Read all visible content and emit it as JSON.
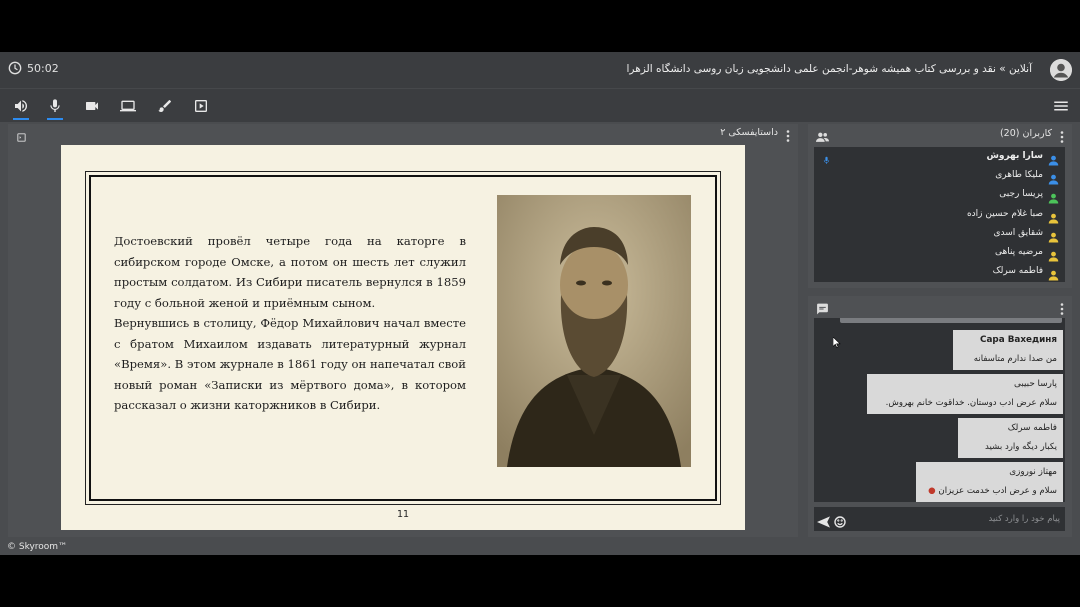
{
  "header": {
    "timer": "50:02",
    "room_title": "آنلاین » نقد و بررسی کتاب همیشه شوهر-انجمن علمی دانشجویی زبان روسی دانشگاه الزهرا"
  },
  "toolbar": {
    "tools": [
      "speaker-icon",
      "microphone-icon",
      "camera-icon",
      "screen-share-icon",
      "brush-icon",
      "play-media-icon"
    ],
    "menu": "hamburger-menu-icon",
    "accent": "#2d8cf0"
  },
  "presentation": {
    "name": "داستایفسکی ۲",
    "page_number": "11",
    "paragraphs": [
      "Достоевский провёл четыре года на каторге в сибирском городе Омске, а потом он шесть лет служил простым солдатом. Из Сибири писатель вернулся в 1859 году с больной женой и приёмным сыном.",
      "Вернувшись в столицу, Фёдор Михайлович начал вместе с братом Михаилом издавать литературный журнал «Время». В этом журнале в 1861 году он напечатал свой новый роман «Записки из мёртвого дома», в котором рассказал о жизни каторжников в Сибири."
    ]
  },
  "users": {
    "title": "کاربران (20)",
    "list": [
      {
        "name": "سارا بهروش",
        "role_color": "#3b8fe8",
        "bold": true,
        "mic": true
      },
      {
        "name": "ملیکا طاهری",
        "role_color": "#3b8fe8",
        "bold": false,
        "mic": false
      },
      {
        "name": "پریسا رجبی",
        "role_color": "#4cc35a",
        "bold": false,
        "mic": false
      },
      {
        "name": "صبا غلام حسین زاده",
        "role_color": "#e8c33b",
        "bold": false,
        "mic": false
      },
      {
        "name": "شقایق اسدی",
        "role_color": "#e8c33b",
        "bold": false,
        "mic": false
      },
      {
        "name": "مرضیه پناهی",
        "role_color": "#e8c33b",
        "bold": false,
        "mic": false
      },
      {
        "name": "فاطمه سرلک",
        "role_color": "#e8c33b",
        "bold": false,
        "mic": false
      }
    ]
  },
  "chat": {
    "messages": [
      {
        "sender": "Сара Вахединя",
        "text": "من صدا ندارم متاسفانه",
        "bold": true
      },
      {
        "sender": "پارسا حبیبی",
        "text": "سلام عرض ادب دوستان. خداقوت خانم بهروش.",
        "bold": false
      },
      {
        "sender": "فاطمه سرلک",
        "text": "یکبار دیگه وارد بشید",
        "bold": false
      },
      {
        "sender": "مهتاز نوروزی",
        "text": "سلام و عرض ادب خدمت عزیزان",
        "bold": false
      }
    ],
    "placeholder": "پیام خود را وارد کنید"
  },
  "footer": {
    "brand": "© Skyroom™"
  }
}
